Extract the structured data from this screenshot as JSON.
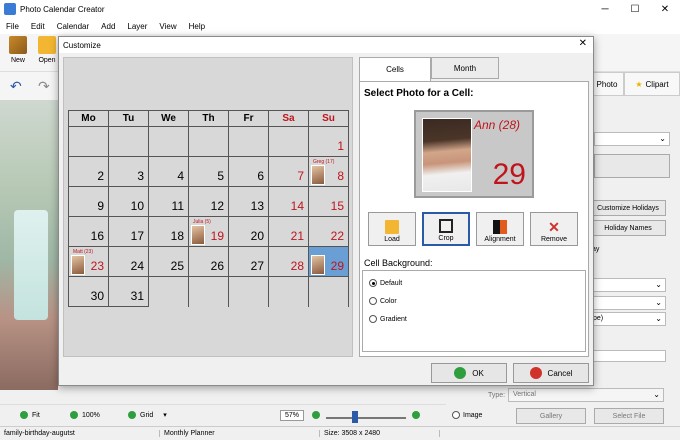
{
  "app": {
    "title": "Photo Calendar Creator",
    "menu": [
      "File",
      "Edit",
      "Calendar",
      "Add",
      "Layer",
      "View",
      "Help"
    ],
    "toolbar": {
      "new": "New",
      "open": "Open"
    }
  },
  "rightpanel": {
    "tab_photo": "Photo",
    "tab_clipart": "Clipart",
    "customize_holidays": "Customize Holidays",
    "holiday_names": "Holiday Names",
    "partial_ay": "ay",
    "partial_pe": "pe)",
    "type_label": "Type:",
    "type_value": "Vertical",
    "image_label": "Image",
    "gallery_btn": "Gallery",
    "select_file_btn": "Select File"
  },
  "status": {
    "fit": "Fit",
    "zoom100": "100%",
    "grid": "Grid",
    "zoom_value": "57%",
    "filename": "family-birthday-augutst",
    "template": "Monthly Planner",
    "size": "Size: 3508 x 2480"
  },
  "dialog": {
    "title": "Customize",
    "weekdays": [
      "Mo",
      "Tu",
      "We",
      "Th",
      "Fr",
      "Sa",
      "Su"
    ],
    "rows": [
      [
        "",
        "",
        "",
        "",
        "",
        "",
        "1"
      ],
      [
        "2",
        "3",
        "4",
        "5",
        "6",
        "7",
        "8"
      ],
      [
        "9",
        "10",
        "11",
        "12",
        "13",
        "14",
        "15"
      ],
      [
        "16",
        "17",
        "18",
        "19",
        "20",
        "21",
        "22"
      ],
      [
        "23",
        "24",
        "25",
        "26",
        "27",
        "28",
        "29"
      ],
      [
        "30",
        "31",
        "",
        "",
        "",
        "",
        ""
      ]
    ],
    "photo_labels": {
      "greg": "Greg (17)",
      "julia": "Julia (5)",
      "matt": "Matt (23)"
    },
    "tabs": {
      "cells": "Cells",
      "month": "Month"
    },
    "select_photo_title": "Select Photo for a Cell:",
    "preview": {
      "name": "Ann (28)",
      "day": "29"
    },
    "actions": {
      "load": "Load",
      "crop": "Crop",
      "alignment": "Alignment",
      "remove": "Remove"
    },
    "cell_background": "Cell Background:",
    "bg_options": {
      "default": "Default",
      "color": "Color",
      "gradient": "Gradient"
    },
    "ok": "OK",
    "cancel": "Cancel"
  }
}
